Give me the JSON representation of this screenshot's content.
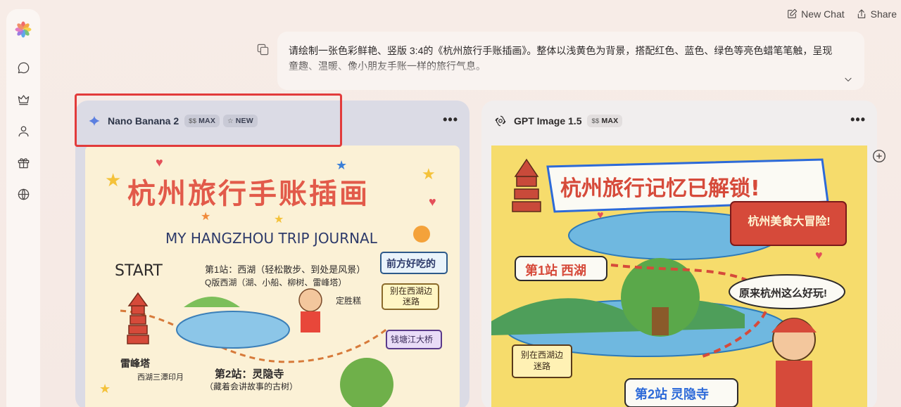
{
  "topbar": {
    "new_chat": "New Chat",
    "share": "Share"
  },
  "sidebar": {
    "items": [
      {
        "icon": "chat-bubble-icon"
      },
      {
        "icon": "crown-icon"
      },
      {
        "icon": "user-icon"
      },
      {
        "icon": "gift-icon"
      },
      {
        "icon": "globe-icon"
      }
    ]
  },
  "prompt": {
    "text_line1": "请绘制一张色彩鲜艳、竖版 3:4的《杭州旅行手账插画》。整体以浅黄色为背景，搭配红色、蓝色、绿色等亮色蜡笔笔触，呈现",
    "text_line2": "童趣、温暖、像小朋友手账一样的旅行气息。"
  },
  "results": [
    {
      "model": "Nano Banana 2",
      "badges": [
        {
          "prefix": "$$",
          "label": "MAX"
        },
        {
          "prefix": "☆",
          "label": "NEW"
        }
      ],
      "image_text": {
        "title": "杭州旅行手账插画",
        "subtitle": "MY HANGZHOU TRIP JOURNAL",
        "start": "START",
        "stop1": "第1站：西湖（轻松散步、到处是风景）",
        "stop1_sub": "Q版西湖（湖、小船、柳树、雷峰塔）",
        "sign1": "前方好吃的",
        "sign2": "别在西湖边迷路",
        "sign3": "钱塘江大桥",
        "snack": "定胜糕",
        "pagoda": "雷峰塔",
        "moon": "西湖三潭印月",
        "stop2": "第2站：灵隐寺",
        "stop2_sub": "（藏着会讲故事的古树）"
      }
    },
    {
      "model": "GPT Image 1.5",
      "badges": [
        {
          "prefix": "$$",
          "label": "MAX"
        }
      ],
      "image_text": {
        "title": "杭州旅行记忆已解锁!",
        "banner": "杭州美食大冒险!",
        "stop1": "第1站 西湖",
        "bubble": "原来杭州这么好玩!",
        "sign": "别在西湖边迷路",
        "stop2": "第2站 灵隐寺"
      }
    }
  ],
  "colors": {
    "highlight": "#e23b3b",
    "left_panel": "#dbdbe5",
    "right_panel": "#f1eeee"
  }
}
